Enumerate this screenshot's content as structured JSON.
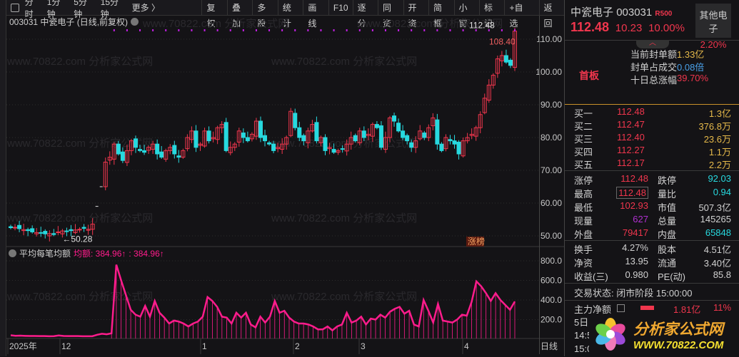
{
  "toolbar": {
    "timeframes": [
      "分时",
      "1分钟",
      "5分钟",
      "15分钟",
      "更多 〉"
    ],
    "buttons": [
      "复权",
      "叠加",
      "多股",
      "统计",
      "画线",
      "F10",
      "逐分",
      "同资",
      "开资",
      "简框",
      "小窗",
      "标记",
      "+自选",
      "返回"
    ]
  },
  "chart": {
    "title": "003031 中瓷电子 (日线,前复权)",
    "watermark": "www.70822.com 分析家公式网",
    "price_ticks": [
      "110.00",
      "100.00",
      "90.00",
      "80.00",
      "70.00",
      "60.00",
      "50.00"
    ],
    "price_values": [
      110,
      100,
      90,
      80,
      70,
      60,
      50
    ],
    "annot_high": "112.48",
    "annot_prev": "108.40",
    "annot_low": "50.28",
    "badge": "涨榜",
    "closes": [
      52.5,
      52.6,
      52.2,
      51.9,
      51.6,
      51.2,
      51.0,
      50.8,
      50.6,
      50.7,
      50.4,
      51.2,
      51.5,
      51.3,
      51.6,
      51.8,
      52.0,
      52.3,
      52.0,
      53.6,
      59.0,
      65.0,
      72.5,
      74,
      78,
      75,
      73,
      76,
      79,
      77,
      76,
      75.5,
      77,
      78,
      75,
      74,
      76,
      77,
      75,
      74,
      76,
      80,
      82,
      77,
      78,
      82,
      79,
      80,
      83,
      84,
      76,
      77,
      78,
      82,
      80,
      79,
      81,
      85,
      80,
      79,
      78,
      76,
      77,
      78,
      80,
      88,
      83,
      80,
      79,
      82,
      84,
      79,
      80,
      76,
      77,
      75.5,
      76,
      76.5,
      78,
      80,
      79,
      82,
      80,
      81,
      84,
      83,
      77,
      80,
      86,
      85,
      82,
      80,
      79,
      77,
      79,
      82,
      80,
      83,
      86,
      78,
      76,
      80,
      79,
      78,
      75,
      79,
      80,
      81,
      83,
      87,
      92,
      96,
      99,
      104,
      105,
      103,
      102,
      112.48
    ],
    "limit_flat": [
      20,
      21
    ]
  },
  "indicator": {
    "name": "平均每笔均额",
    "label1": "均额: 384.96↑",
    "label2": ": 384.96↑",
    "ticks": [
      "800.0",
      "600.0",
      "400.0",
      "200.0"
    ],
    "tick_values": [
      800,
      600,
      400,
      200
    ],
    "values": [
      40,
      35,
      36,
      34,
      33,
      33,
      32,
      32,
      30,
      31,
      38,
      33,
      32,
      32,
      32,
      30,
      30,
      30,
      45,
      55,
      50,
      60,
      760,
      600,
      450,
      300,
      250,
      230,
      340,
      230,
      390,
      270,
      220,
      160,
      190,
      180,
      160,
      130,
      160,
      180,
      230,
      430,
      390,
      330,
      230,
      220,
      160,
      270,
      220,
      270,
      150,
      120,
      230,
      170,
      230,
      390,
      270,
      290,
      220,
      180,
      160,
      160,
      150,
      130,
      100,
      100,
      130,
      90,
      130,
      150,
      270,
      170,
      190,
      230,
      150,
      210,
      200,
      250,
      220,
      280,
      310,
      330,
      260,
      290,
      150,
      130,
      400,
      290,
      170,
      360,
      190,
      180,
      170,
      200,
      250,
      240,
      380,
      590,
      540,
      470,
      390,
      470,
      400,
      350,
      300,
      385
    ]
  },
  "xaxis": {
    "labels": [
      "2025年",
      "12",
      "1",
      "2",
      "3",
      "4"
    ],
    "period": "日线"
  },
  "quote": {
    "name": "中瓷电子",
    "code": "003031",
    "r": "R500",
    "price": "112.48",
    "change": "10.23",
    "pct": "10.00%",
    "sector": "其他电子",
    "sector_pct": "2.20%",
    "board": "首板",
    "seal_label": "当前封单额",
    "seal": "1.33亿",
    "ratio_label": "封单占成交",
    "ratio": "0.08倍",
    "ten_label": "十日总涨幅",
    "ten": "39.70%",
    "bids": [
      {
        "l": "买一",
        "p": "112.48",
        "v": "1.3亿"
      },
      {
        "l": "买二",
        "p": "112.47",
        "v": "376.8万"
      },
      {
        "l": "买三",
        "p": "112.40",
        "v": "23.6万"
      },
      {
        "l": "买四",
        "p": "112.27",
        "v": "1.1万"
      },
      {
        "l": "买五",
        "p": "112.17",
        "v": "2.2万"
      }
    ],
    "stats": [
      [
        "涨停",
        "112.48",
        "red",
        "跌停",
        "92.03",
        "cy"
      ],
      [
        "最高",
        "112.48",
        "red",
        "量比",
        "0.94",
        "cy"
      ],
      [
        "最低",
        "102.93",
        "red",
        "市值",
        "507.3亿",
        "wh"
      ],
      [
        "现量",
        "627",
        "pu",
        "总量",
        "145265",
        "wh"
      ],
      [
        "外盘",
        "79417",
        "red",
        "内盘",
        "65848",
        "cy"
      ]
    ],
    "fund": [
      [
        "换手",
        "4.27%",
        "股本",
        "4.51亿"
      ],
      [
        "净资",
        "13.95",
        "流通",
        "3.40亿"
      ],
      [
        "收益(三)",
        "0.980",
        "PE(动)",
        "85.8"
      ]
    ],
    "status": "交易状态: 闭市阶段 15:00:00",
    "main_label": "主力净额",
    "main_val": "1.81亿",
    "main_pct": "11%",
    "five": "5日",
    "t1": "14:5",
    "t2": "15:0"
  },
  "logo": {
    "cn": "分析家公式网",
    "url": "WWW.70822.COM"
  },
  "colors": {
    "up": "#f0364d",
    "down": "#27d9df",
    "ind": "#ff1c8c",
    "bg": "#141316"
  }
}
